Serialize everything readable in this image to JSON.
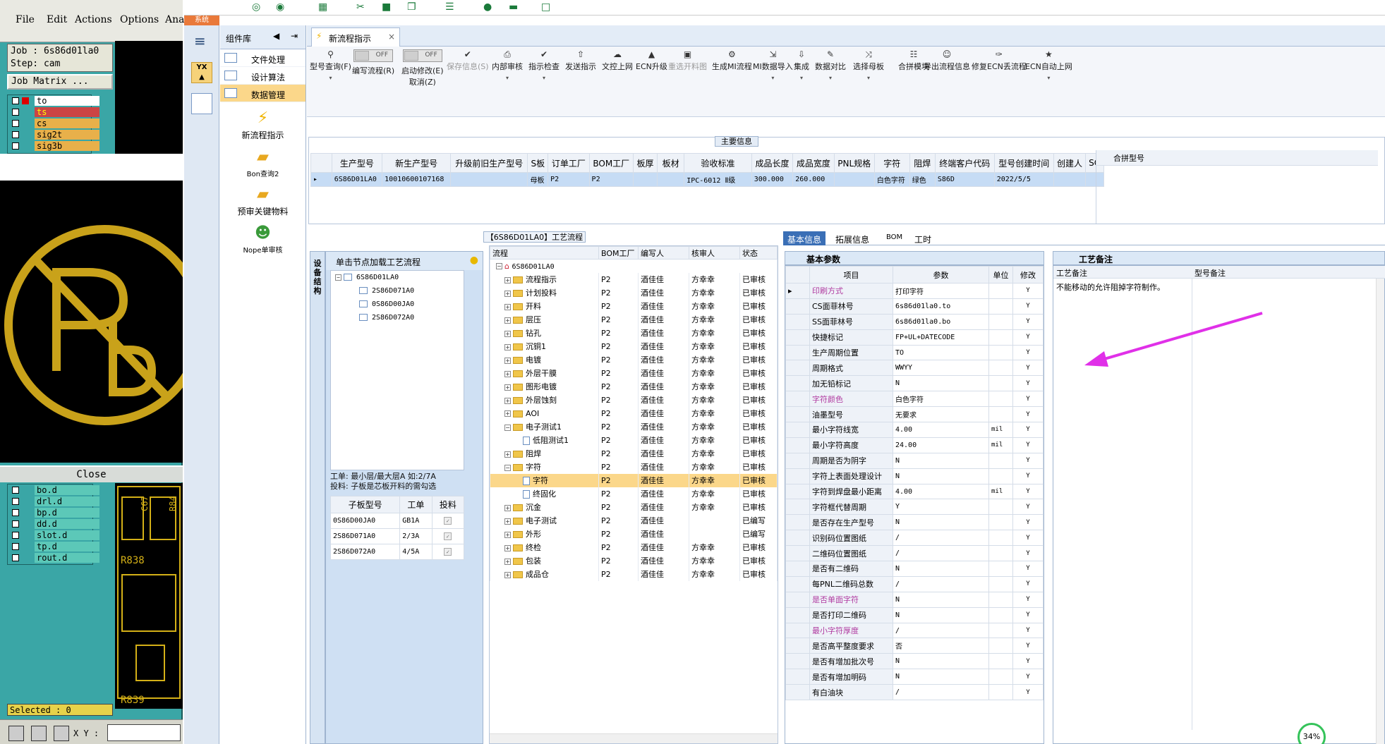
{
  "cam": {
    "menu": [
      "File",
      "Edit",
      "Actions",
      "Options",
      "Ana"
    ],
    "job_line": "Job : 6s86d01la0",
    "step_line": "Step: cam",
    "job_matrix": "Job Matrix ...",
    "layers_top": [
      "to",
      "ts",
      "cs",
      "sig2t",
      "sig3b"
    ],
    "layers_bottom": [
      "bo.d",
      "drl.d",
      "bp.d",
      "dd.d",
      "slot.d",
      "tp.d",
      "rout.d"
    ],
    "close": "Close",
    "selected": "Selected : 0",
    "xy": "X Y :",
    "pcb_labels": [
      "R838",
      "R839",
      "C67",
      "R84"
    ]
  },
  "app": {
    "sys_tab": "系统",
    "complib_title": "组件库",
    "lib_items": [
      "文件处理",
      "设计算法",
      "数据管理"
    ],
    "big_items": [
      "新流程指示",
      "Bon查询2",
      "预审关键物料",
      "Nope单审核"
    ],
    "doc_tab": "新流程指示",
    "toolbar": [
      {
        "icon": "search-icon",
        "label": "型号查询(F)",
        "dd": true
      },
      {
        "icon": "toggle",
        "label": "编写流程(R)",
        "toggle": "OFF"
      },
      {
        "icon": "toggle",
        "label": "启动修改(E)",
        "label2": "取消(Z)",
        "toggle": "OFF"
      },
      {
        "icon": "check-icon",
        "label": "保存信息(S)",
        "disabled": true
      },
      {
        "icon": "print-icon",
        "label": "内部审核",
        "dd": true
      },
      {
        "icon": "check-icon",
        "label": "指示检查",
        "dd": true
      },
      {
        "icon": "upload-icon",
        "label": "发送指示"
      },
      {
        "icon": "cloud-upload-icon",
        "label": "文控上网"
      },
      {
        "icon": "ecn-icon",
        "label": "ECN升级"
      },
      {
        "icon": "image-icon",
        "label": "重选开料图",
        "disabled": true
      },
      {
        "icon": "gears-icon",
        "label": "生成MI流程"
      },
      {
        "icon": "import-icon",
        "label": "MI数据导入",
        "dd": true
      },
      {
        "icon": "download-icon",
        "label": "集成",
        "dd": true
      },
      {
        "icon": "compare-icon",
        "label": "数据对比",
        "dd": true
      },
      {
        "icon": "shuffle-icon",
        "label": "选择母板",
        "dd": true
      },
      {
        "icon": "list-icon",
        "label": "合拼模块"
      },
      {
        "icon": "smile-icon",
        "label": "导出流程信息"
      },
      {
        "icon": "wrench-icon",
        "label": "修复ECN丢流程"
      },
      {
        "icon": "star-icon",
        "label": "ECN自动上网",
        "dd": true
      }
    ],
    "main_info_title": "主要信息",
    "main_cols": [
      "生产型号",
      "新生产型号",
      "升级前旧生产型号",
      "S板",
      "订单工厂",
      "BOM工厂",
      "板厚",
      "板材",
      "验收标准",
      "成品长度",
      "成品宽度",
      "PNL规格",
      "字符",
      "阻焊",
      "终端客户代码",
      "型号创建时间",
      "创建人",
      "SO"
    ],
    "main_row": [
      "6S86D01LA0",
      "10010600107168",
      "",
      "母板",
      "P2",
      "P2",
      "",
      "",
      "IPC-6012 Ⅱ级",
      "300.000",
      "260.000",
      "",
      "白色字符",
      "绿色",
      "S86D",
      "2022/5/5",
      "",
      ""
    ],
    "merge_col": "合拼型号",
    "flow_header": "【6S86D01LA0】工艺流程",
    "vtab": "设备结构",
    "lp_header": "单击节点加载工艺流程",
    "lp_tree_root": "6S86D01LA0",
    "lp_tree_children": [
      "2S86D071A0",
      "0S86D00JA0",
      "2S86D072A0"
    ],
    "lp_note1": "工单: 最小层/最大层A 如:2/7A",
    "lp_note2": "投料: 子板是芯板开料的需勾选",
    "lp_cols": [
      "子板型号",
      "工单",
      "投料"
    ],
    "lp_rows": [
      [
        "0S86D00JA0",
        "GB1A"
      ],
      [
        "2S86D071A0",
        "2/3A"
      ],
      [
        "2S86D072A0",
        "4/5A"
      ]
    ],
    "flow_cols": [
      "流程",
      "BOM工厂",
      "编写人",
      "核审人",
      "状态"
    ],
    "flow_root": "6S86D01LA0",
    "flow_rows": [
      {
        "name": "流程指示",
        "lvl": 1,
        "f": "P2",
        "w": "酒佳佳",
        "r": "方幸幸",
        "s": "已审核"
      },
      {
        "name": "计划投料",
        "lvl": 1,
        "f": "P2",
        "w": "酒佳佳",
        "r": "方幸幸",
        "s": "已审核"
      },
      {
        "name": "开料",
        "lvl": 1,
        "f": "P2",
        "w": "酒佳佳",
        "r": "方幸幸",
        "s": "已审核"
      },
      {
        "name": "层压",
        "lvl": 1,
        "f": "P2",
        "w": "酒佳佳",
        "r": "方幸幸",
        "s": "已审核"
      },
      {
        "name": "钻孔",
        "lvl": 1,
        "f": "P2",
        "w": "酒佳佳",
        "r": "方幸幸",
        "s": "已审核"
      },
      {
        "name": "沉铜1",
        "lvl": 1,
        "f": "P2",
        "w": "酒佳佳",
        "r": "方幸幸",
        "s": "已审核"
      },
      {
        "name": "电镀",
        "lvl": 1,
        "f": "P2",
        "w": "酒佳佳",
        "r": "方幸幸",
        "s": "已审核"
      },
      {
        "name": "外层干膜",
        "lvl": 1,
        "f": "P2",
        "w": "酒佳佳",
        "r": "方幸幸",
        "s": "已审核"
      },
      {
        "name": "图形电镀",
        "lvl": 1,
        "f": "P2",
        "w": "酒佳佳",
        "r": "方幸幸",
        "s": "已审核"
      },
      {
        "name": "外层蚀刻",
        "lvl": 1,
        "f": "P2",
        "w": "酒佳佳",
        "r": "方幸幸",
        "s": "已审核"
      },
      {
        "name": "AOI",
        "lvl": 1,
        "f": "P2",
        "w": "酒佳佳",
        "r": "方幸幸",
        "s": "已审核"
      },
      {
        "name": "电子测试1",
        "lvl": 1,
        "f": "P2",
        "w": "酒佳佳",
        "r": "方幸幸",
        "s": "已审核",
        "open": true
      },
      {
        "name": "低阻测试1",
        "lvl": 2,
        "f": "P2",
        "w": "酒佳佳",
        "r": "方幸幸",
        "s": "已审核"
      },
      {
        "name": "阻焊",
        "lvl": 1,
        "f": "P2",
        "w": "酒佳佳",
        "r": "方幸幸",
        "s": "已审核"
      },
      {
        "name": "字符",
        "lvl": 1,
        "f": "P2",
        "w": "酒佳佳",
        "r": "方幸幸",
        "s": "已审核",
        "open": true
      },
      {
        "name": "字符",
        "lvl": 2,
        "f": "P2",
        "w": "酒佳佳",
        "r": "方幸幸",
        "s": "已审核",
        "hl": true
      },
      {
        "name": "终固化",
        "lvl": 2,
        "f": "P2",
        "w": "酒佳佳",
        "r": "方幸幸",
        "s": "已审核"
      },
      {
        "name": "沉金",
        "lvl": 1,
        "f": "P2",
        "w": "酒佳佳",
        "r": "方幸幸",
        "s": "已审核"
      },
      {
        "name": "电子测试",
        "lvl": 1,
        "f": "P2",
        "w": "酒佳佳",
        "r": "",
        "s": "已编写"
      },
      {
        "name": "外形",
        "lvl": 1,
        "f": "P2",
        "w": "酒佳佳",
        "r": "",
        "s": "已编写"
      },
      {
        "name": "终检",
        "lvl": 1,
        "f": "P2",
        "w": "酒佳佳",
        "r": "方幸幸",
        "s": "已审核"
      },
      {
        "name": "包装",
        "lvl": 1,
        "f": "P2",
        "w": "酒佳佳",
        "r": "方幸幸",
        "s": "已审核"
      },
      {
        "name": "成品仓",
        "lvl": 1,
        "f": "P2",
        "w": "酒佳佳",
        "r": "方幸幸",
        "s": "已审核"
      }
    ],
    "rp_tabs": [
      "基本信息",
      "拓展信息",
      "BOM",
      "工时"
    ],
    "basic_title": "基本参数",
    "param_cols": [
      "项目",
      "参数",
      "单位",
      "修改"
    ],
    "params": [
      {
        "n": "印刷方式",
        "v": "打印字符",
        "u": "",
        "m": "Y",
        "pink": true
      },
      {
        "n": "CS面菲林号",
        "v": "6s86d01la0.to",
        "u": "",
        "m": "Y"
      },
      {
        "n": "SS面菲林号",
        "v": "6s86d01la0.bo",
        "u": "",
        "m": "Y"
      },
      {
        "n": "快捷标记",
        "v": "FP+UL+DATECODE",
        "u": "",
        "m": "Y"
      },
      {
        "n": "生产周期位置",
        "v": "TO",
        "u": "",
        "m": "Y"
      },
      {
        "n": "周期格式",
        "v": "WWYY",
        "u": "",
        "m": "Y"
      },
      {
        "n": "加无铅标记",
        "v": "N",
        "u": "",
        "m": "Y"
      },
      {
        "n": "字符颜色",
        "v": "白色字符",
        "u": "",
        "m": "Y",
        "pink": true
      },
      {
        "n": "油墨型号",
        "v": "无要求",
        "u": "",
        "m": "Y"
      },
      {
        "n": "最小字符线宽",
        "v": "4.00",
        "u": "mil",
        "m": "Y"
      },
      {
        "n": "最小字符高度",
        "v": "24.00",
        "u": "mil",
        "m": "Y"
      },
      {
        "n": "周期是否为阴字",
        "v": "N",
        "u": "",
        "m": "Y"
      },
      {
        "n": "字符上表面处理设计",
        "v": "N",
        "u": "",
        "m": "Y"
      },
      {
        "n": "字符到焊盘最小距离",
        "v": "4.00",
        "u": "mil",
        "m": "Y"
      },
      {
        "n": "字符框代替周期",
        "v": "Y",
        "u": "",
        "m": "Y"
      },
      {
        "n": "是否存在生产型号",
        "v": "N",
        "u": "",
        "m": "Y"
      },
      {
        "n": "识别码位置图纸",
        "v": "/",
        "u": "",
        "m": "Y"
      },
      {
        "n": "二维码位置图纸",
        "v": "/",
        "u": "",
        "m": "Y"
      },
      {
        "n": "是否有二维码",
        "v": "N",
        "u": "",
        "m": "Y"
      },
      {
        "n": "每PNL二维码总数",
        "v": "/",
        "u": "",
        "m": "Y"
      },
      {
        "n": "是否单面字符",
        "v": "N",
        "u": "",
        "m": "Y",
        "pink": true
      },
      {
        "n": "是否打印二维码",
        "v": "N",
        "u": "",
        "m": "Y"
      },
      {
        "n": "最小字符厚度",
        "v": "/",
        "u": "",
        "m": "Y",
        "pink": true
      },
      {
        "n": "是否高平整度要求",
        "v": "否",
        "u": "",
        "m": "Y"
      },
      {
        "n": "是否有增加批次号",
        "v": "N",
        "u": "",
        "m": "Y"
      },
      {
        "n": "是否有增加明码",
        "v": "N",
        "u": "",
        "m": "Y"
      },
      {
        "n": "有白油块",
        "v": "/",
        "u": "",
        "m": "Y"
      }
    ],
    "craft_title": "工艺备注",
    "craft_cols": [
      "工艺备注",
      "型号备注"
    ],
    "craft_note": "不能移动的允许阻掉字符制作。",
    "progress": "34%"
  }
}
